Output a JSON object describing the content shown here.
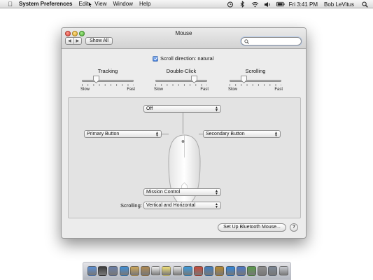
{
  "menubar": {
    "app": "System Preferences",
    "items": [
      "Edit",
      "View",
      "Window",
      "Help"
    ],
    "clock": "Fri 3:41 PM",
    "user": "Bob LeVitus",
    "status_icons": [
      "time-machine-icon",
      "bluetooth-icon",
      "wifi-icon",
      "volume-icon",
      "battery-icon",
      "spotlight-icon"
    ]
  },
  "window": {
    "title": "Mouse",
    "show_all_label": "Show All",
    "search": {
      "value": "",
      "placeholder": ""
    }
  },
  "scroll_direction": {
    "label": "Scroll direction: natural",
    "checked": true
  },
  "sliders": [
    {
      "title": "Tracking",
      "min_label": "Slow",
      "max_label": "Fast",
      "level": 0.28
    },
    {
      "title": "Double-Click",
      "min_label": "Slow",
      "max_label": "Fast",
      "level": 0.75
    },
    {
      "title": "Scrolling",
      "min_label": "Slow",
      "max_label": "Fast",
      "level": 0.28
    }
  ],
  "buttons": {
    "top": "Off",
    "primary": "Primary Button",
    "secondary": "Secondary Button",
    "bottom": "Mission Control"
  },
  "scrolling": {
    "label": "Scrolling:",
    "value": "Vertical and Horizontal"
  },
  "setup_label": "Set Up Bluetooth Mouse...",
  "help_label": "?",
  "colors": {
    "selection_blue": "#3f7ad8",
    "window_bg": "#ececec",
    "panel_bg": "#e3e3e3"
  },
  "dock_icons": [
    "finder-icon",
    "dashboard-icon",
    "mission-control-icon",
    "safari-icon",
    "mail-icon",
    "contacts-icon",
    "calendar-icon",
    "notes-icon",
    "reminders-icon",
    "itunes-icon",
    "photo-booth-icon",
    "iphoto-icon",
    "garageband-icon",
    "app-store-icon",
    "preview-icon",
    "facetime-icon",
    "system-preferences-icon",
    "utilities-icon",
    "trash-icon"
  ]
}
